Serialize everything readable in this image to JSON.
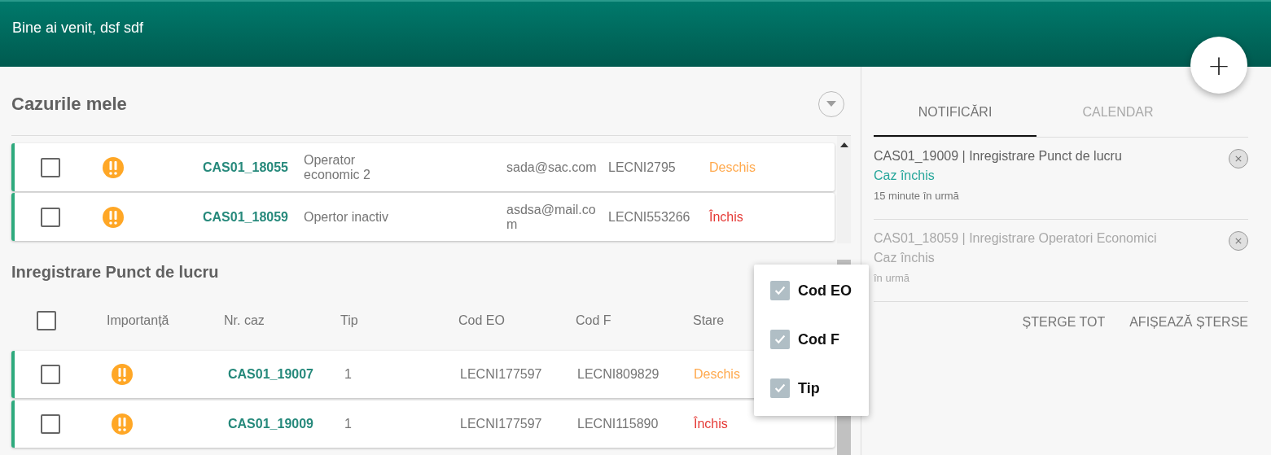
{
  "header": {
    "welcome": "Bine ai venit, dsf sdf",
    "add_button": "+"
  },
  "my_cases": {
    "title": "Cazurile mele",
    "rows": [
      {
        "checked": false,
        "case": "CAS01_18055",
        "type": "Operator economic 2",
        "email": "sada@sac.com",
        "code": "LECNI2795",
        "status": "Deschis",
        "color": "#ffa94d"
      },
      {
        "checked": false,
        "case": "CAS01_18059",
        "type": "Opertor inactiv",
        "email": "asdsa@mail.com",
        "code": "LECNI553266",
        "status": "Închis",
        "color": "#e53935"
      }
    ]
  },
  "section": {
    "title": "Inregistrare Punct de lucru",
    "select_all": false,
    "columns": [
      "Importanță",
      "Nr. caz",
      "Tip",
      "Cod EO",
      "Cod F",
      "Stare"
    ],
    "rows": [
      {
        "checked": false,
        "case": "CAS01_19007",
        "tip": "1",
        "cod_eo": "LECNI177597",
        "cod_f": "LECNI809829",
        "status": "Deschis",
        "color": "#ffa94d"
      },
      {
        "checked": false,
        "case": "CAS01_19009",
        "tip": "1",
        "cod_eo": "LECNI177597",
        "cod_f": "LECNI115890",
        "status": "Închis",
        "color": "#e53935"
      }
    ]
  },
  "column_menu": [
    {
      "label": "Cod EO",
      "checked": true
    },
    {
      "label": "Cod F",
      "checked": true
    },
    {
      "label": "Tip",
      "checked": true
    }
  ],
  "tabs": [
    {
      "label": "NOTIFICĂRI",
      "selected": true
    },
    {
      "label": "CALENDAR",
      "selected": false
    }
  ],
  "notifications": [
    {
      "title": "CAS01_19009 | Inregistrare Punct de lucru",
      "status": "Caz închis",
      "time": "15 minute în urmă",
      "dimmed": false
    },
    {
      "title": "CAS01_18059 | Inregistrare Operatori Economici",
      "status": "Caz închis",
      "time": "în urmă",
      "dimmed": true
    }
  ],
  "actions": [
    "ȘTERGE TOT",
    "AFIȘEAZĂ ȘTERSE"
  ]
}
